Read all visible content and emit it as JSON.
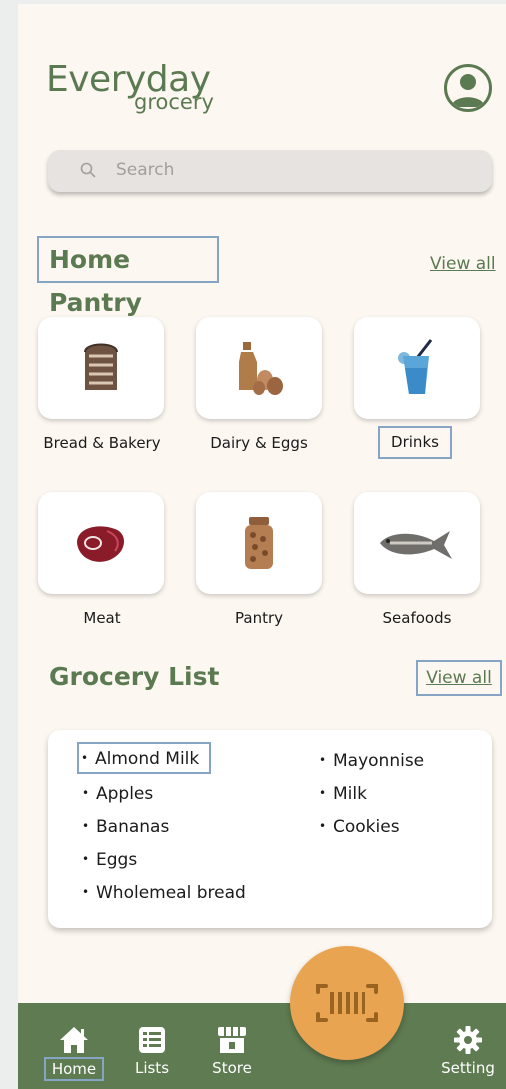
{
  "header": {
    "logo_line1": "Everyday",
    "logo_line2": "grocery",
    "avatar_icon": "user-avatar-icon"
  },
  "search": {
    "placeholder": "Search",
    "icon": "search-icon"
  },
  "home_pantry": {
    "title": "Home Pantry",
    "view_all": "View all",
    "categories": [
      {
        "label": "Bread & Bakery",
        "icon": "bread-icon"
      },
      {
        "label": "Dairy & Eggs",
        "icon": "dairy-eggs-icon"
      },
      {
        "label": "Drinks",
        "icon": "drink-glass-icon"
      },
      {
        "label": "Meat",
        "icon": "steak-icon"
      },
      {
        "label": "Pantry",
        "icon": "jar-icon"
      },
      {
        "label": "Seafoods",
        "icon": "fish-icon"
      }
    ]
  },
  "grocery_list": {
    "title": "Grocery List",
    "view_all": "View all",
    "items_left": [
      "Almond Milk",
      "Apples",
      "Bananas",
      "Eggs",
      "Wholemeal bread"
    ],
    "items_right": [
      "Mayonnise",
      "Milk",
      "Cookies"
    ],
    "bullet": "•"
  },
  "nav": {
    "items": [
      {
        "label": "Home",
        "icon": "home-icon"
      },
      {
        "label": "Lists",
        "icon": "list-icon"
      },
      {
        "label": "Store",
        "icon": "store-icon"
      },
      {
        "label": "Setting",
        "icon": "gear-icon"
      }
    ],
    "scan_icon": "barcode-scan-icon"
  },
  "colors": {
    "brand_green": "#5c7a52",
    "background": "#fdf7f1",
    "scan_orange": "#e9a452",
    "highlight": "#86a5c4"
  }
}
